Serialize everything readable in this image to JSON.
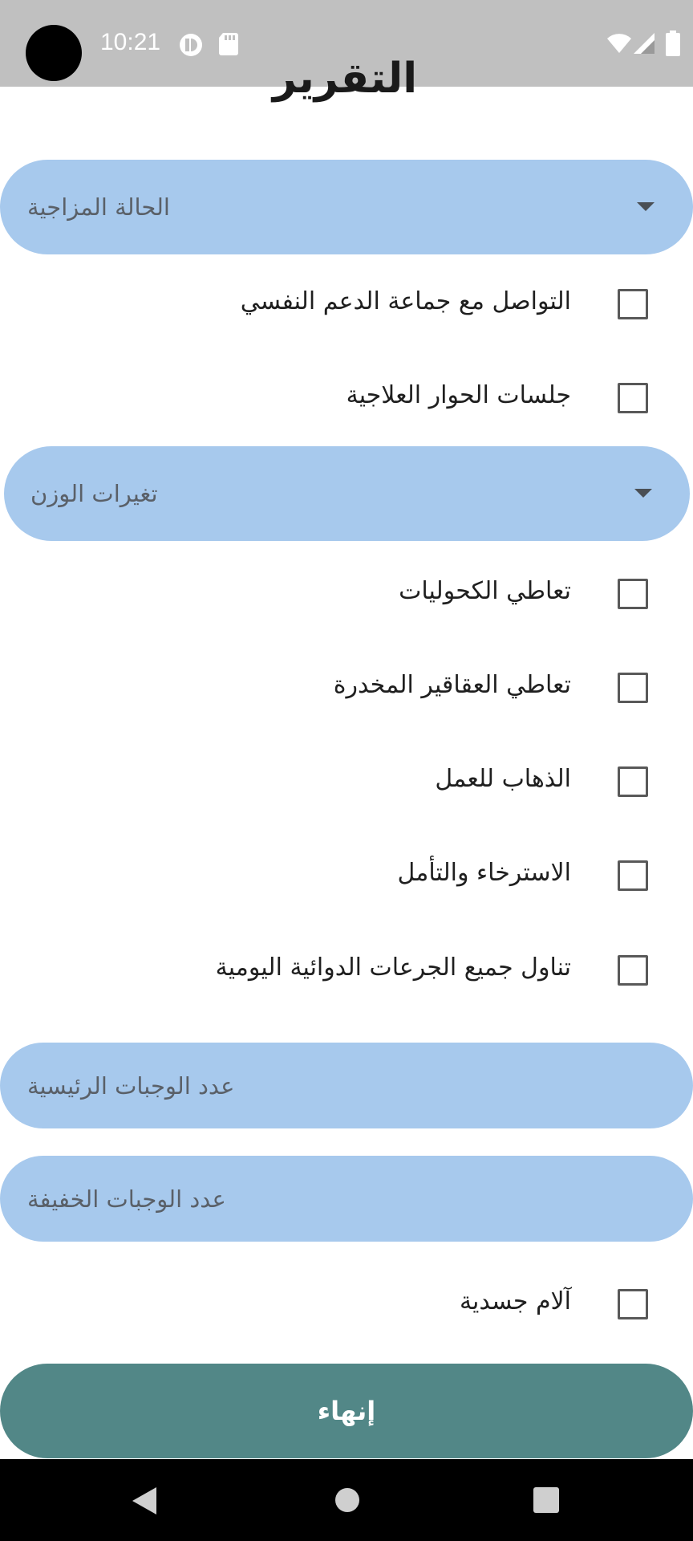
{
  "status_bar": {
    "time": "10:21",
    "icons": [
      "media-status-icon",
      "sd-card-icon",
      "wifi-icon",
      "signal-icon",
      "battery-icon"
    ]
  },
  "page": {
    "title": "التقرير"
  },
  "mood_dropdown": {
    "label": "الحالة المزاجية"
  },
  "group1": [
    {
      "label": "التواصل مع جماعة الدعم النفسي",
      "checked": false
    },
    {
      "label": "جلسات الحوار العلاجية",
      "checked": false
    }
  ],
  "weight_dropdown": {
    "label": "تغيرات الوزن"
  },
  "group2": [
    {
      "label": "تعاطي الكحوليات",
      "checked": false
    },
    {
      "label": "تعاطي  العقاقير المخدرة",
      "checked": false
    },
    {
      "label": "الذهاب للعمل",
      "checked": false
    },
    {
      "label": "الاسترخاء والتأمل",
      "checked": false
    },
    {
      "label": "تناول جميع الجرعات الدوائية اليومية",
      "checked": false
    }
  ],
  "main_meals_input": {
    "placeholder": "عدد الوجبات الرئيسية"
  },
  "snack_meals_input": {
    "placeholder": "عدد الوجبات الخفيفة"
  },
  "group3": [
    {
      "label": "آلام جسدية",
      "checked": false
    }
  ],
  "finish_button": {
    "label": "إنهاء"
  },
  "colors": {
    "field_bg": "#a7c9ed",
    "button_bg": "#528787",
    "status_bar": "#c0c0c0",
    "nav_bar": "#000000"
  }
}
